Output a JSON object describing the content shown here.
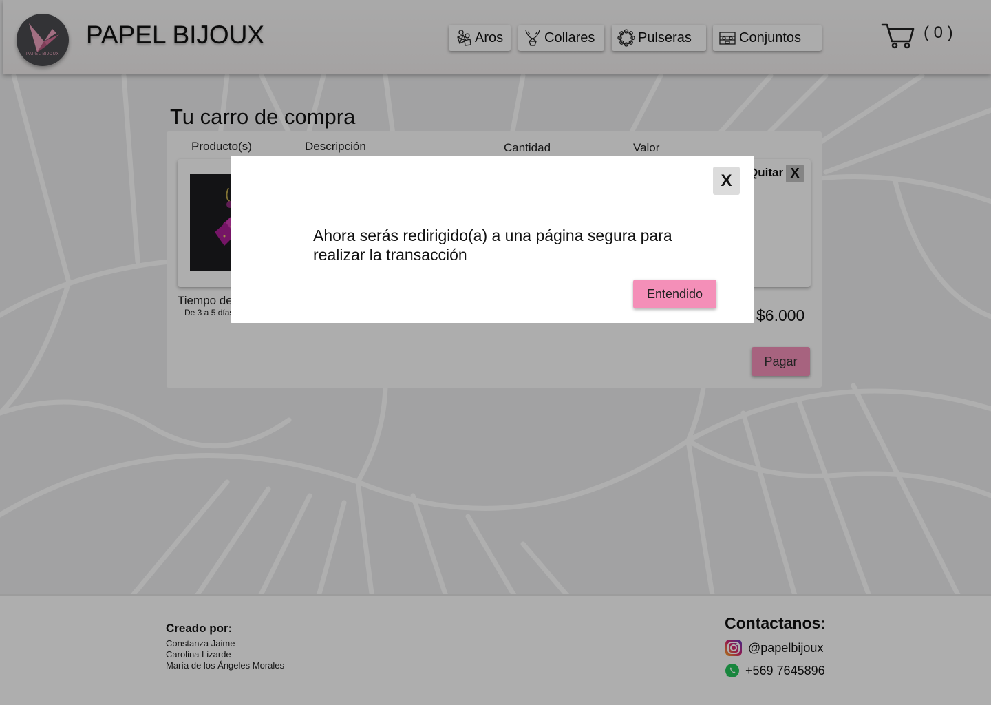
{
  "header": {
    "brand": "PAPEL BIJOUX",
    "logo_text": "PAPEL BIJOUX",
    "nav": [
      {
        "label": "Aros",
        "icon": "earrings-icon"
      },
      {
        "label": "Collares",
        "icon": "necklace-icon"
      },
      {
        "label": "Pulseras",
        "icon": "bracelet-icon"
      },
      {
        "label": "Conjuntos",
        "icon": "jewelry-box-icon"
      }
    ],
    "cart_icon": "cart-icon",
    "cart_count": "( 0 )"
  },
  "cart": {
    "title": "Tu carro de compra",
    "columns": [
      "Producto(s)",
      "Descripción",
      "Cantidad",
      "Valor"
    ],
    "item": {
      "image": "product-image",
      "remove_label": "Quitar",
      "remove_icon": "X"
    },
    "delivery_label": "Tiempo de entrega",
    "delivery_value": "De 3 a 5 días",
    "total": "$6.000",
    "pay_label": "Pagar"
  },
  "modal": {
    "close_label": "X",
    "message": "Ahora serás redirigido(a) a una página segura para realizar la transacción",
    "confirm_label": "Entendido"
  },
  "footer": {
    "created_title": "Creado por:",
    "authors": [
      "Constanza Jaime",
      "Carolina Lizarde",
      "María de los Ángeles Morales"
    ],
    "contact_title": "Contactanos:",
    "instagram": "@papelbijoux",
    "whatsapp": "+569 7645896"
  },
  "colors": {
    "accent_pink": "#f48fb8",
    "logo_bg": "#4a4a4e",
    "logo_bird": "#e8a0bb",
    "overlay": "rgba(0,0,0,0.30)"
  }
}
